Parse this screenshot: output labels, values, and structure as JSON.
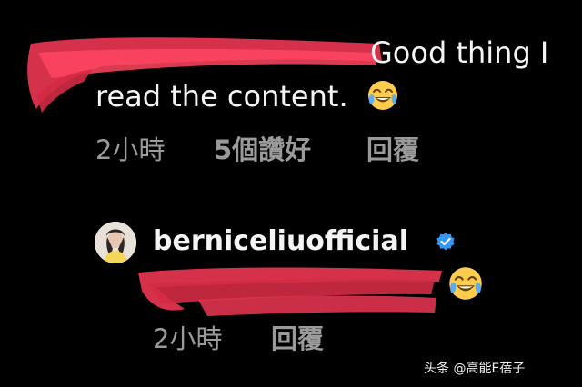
{
  "comment_1": {
    "text_line_1": "Good thing I",
    "text_line_2": "read the content.",
    "emoji": "tears-of-joy-emoji",
    "time": "2小時",
    "likes": "5個讚好",
    "reply": "回覆"
  },
  "comment_2": {
    "username": "berniceliuofficial",
    "verified_icon": "verified-badge-icon",
    "emoji": "tears-of-joy-emoji",
    "time": "2小時",
    "reply": "回覆"
  },
  "watermark": {
    "text": "头条 @高能E蓓子"
  },
  "colors": {
    "background": "#000000",
    "text": "#f4f4f4",
    "meta": "#9a9a9a",
    "redaction": "#e0344f",
    "verified": "#3797f0"
  }
}
